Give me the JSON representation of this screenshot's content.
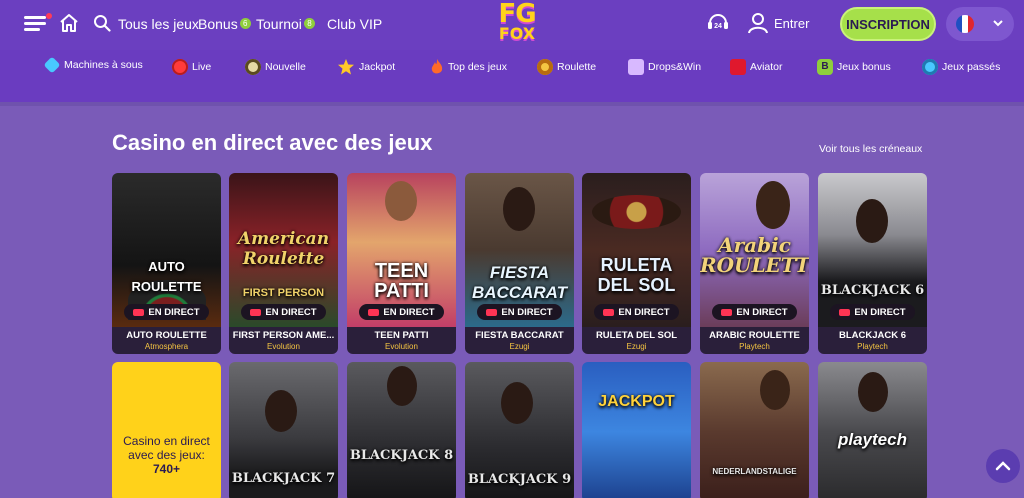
{
  "header": {
    "nav": [
      {
        "label": "Tous les jeux",
        "badge": ""
      },
      {
        "label": "Bonus",
        "badge": "6"
      },
      {
        "label": "Tournoi",
        "badge": "8"
      },
      {
        "label": "Club VIP",
        "badge": ""
      }
    ],
    "logo_top": "FG",
    "logo_bottom": "FOX",
    "support_badge": "24",
    "login_label": "Entrer",
    "signup_label": "INSCRIPTION",
    "accent_color": "#a6e04a",
    "brand_color": "#6b3fc0"
  },
  "categories": [
    {
      "label": "Machines à sous",
      "icon": "diamond-icon",
      "color": "#49c8ff"
    },
    {
      "label": "Live",
      "icon": "live-icon",
      "color": "#ff3b3b"
    },
    {
      "label": "Nouvelle",
      "icon": "new-icon",
      "color": "#e5d8a4"
    },
    {
      "label": "Jackpot",
      "icon": "star-icon",
      "color": "#ffc928"
    },
    {
      "label": "Top des jeux",
      "icon": "fire-icon",
      "color": "#ff6a2a"
    },
    {
      "label": "Roulette",
      "icon": "roulette-icon",
      "color": "#f5c542"
    },
    {
      "label": "Drops&Win",
      "icon": "drops-icon",
      "color": "#d8b9ff"
    },
    {
      "label": "Aviator",
      "icon": "aviator-icon",
      "color": "#e0182d"
    },
    {
      "label": "Jeux bonus",
      "icon": "bonus-icon",
      "color": "#8fce3c"
    },
    {
      "label": "Jeux passés",
      "icon": "history-icon",
      "color": "#49c8ff"
    }
  ],
  "section": {
    "title": "Casino en direct avec des jeux",
    "see_all": "Voir tous les créneaux"
  },
  "live_label": "EN DIRECT",
  "row1": [
    {
      "title_art": "AUTO ROULETTE",
      "name": "AUTO ROULETTE",
      "provider": "Atmosphera",
      "bg": "#202020"
    },
    {
      "title_art": "American Roulette",
      "name": "FIRST PERSON AME...",
      "provider": "Evolution",
      "bg": "#7e1f24"
    },
    {
      "title_art": "TEEN PATTI",
      "name": "TEEN PATTI",
      "provider": "Evolution",
      "bg": "#c24f78"
    },
    {
      "title_art": "FIESTA BACCARAT",
      "name": "FIESTA BACCARAT",
      "provider": "Ezugi",
      "bg": "#5b4a3c"
    },
    {
      "title_art": "RULETA DEL SOL",
      "name": "RULETA DEL SOL",
      "provider": "Ezugi",
      "bg": "#3a2b2b"
    },
    {
      "title_art": "Arabic ROULETTE",
      "name": "ARABIC ROULETTE",
      "provider": "Playtech",
      "bg": "#8e6bc0"
    },
    {
      "title_art": "BLACKJACK 6",
      "name": "BLACKJACK 6",
      "provider": "Playtech",
      "bg": "#6e6e74"
    }
  ],
  "promo": {
    "line1": "Casino en direct",
    "line2": "avec des jeux:",
    "count": "740+"
  },
  "row2": [
    {
      "title_art": "BLACKJACK 7",
      "bg": "#4c4c50"
    },
    {
      "title_art": "BLACKJACK 8",
      "bg": "#3a3a3e"
    },
    {
      "title_art": "BLACKJACK 9",
      "bg": "#38383c"
    },
    {
      "title_art": "JACKPOT",
      "bg": "#2f6ec8"
    },
    {
      "title_art": "NEDERLANDSTALIGE",
      "bg": "#5a3a2e"
    },
    {
      "title_art": "playtech",
      "bg": "#4a4a4e"
    }
  ]
}
